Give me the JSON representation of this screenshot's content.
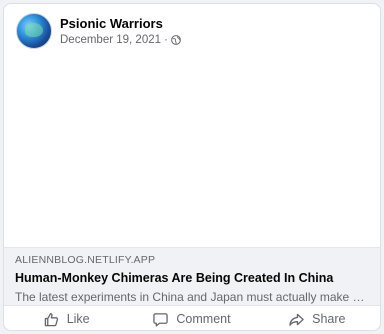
{
  "post": {
    "author": "Psionic Warriors",
    "date": "December 19, 2021",
    "separator": "·",
    "audience_icon": "globe-icon",
    "avatar_icon": "earth-globe-avatar"
  },
  "link_preview": {
    "domain": "ALIENNBLOG.NETLIFY.APP",
    "title": "Human-Monkey Chimeras Are Being Created In China",
    "description": "The latest experiments in China and Japan must actually make us e..."
  },
  "actions": {
    "like_label": "Like",
    "like_icon": "thumbs-up-icon",
    "comment_label": "Comment",
    "comment_icon": "comment-bubble-icon",
    "share_label": "Share",
    "share_icon": "share-arrow-icon"
  },
  "colors": {
    "text_primary": "#050505",
    "text_secondary": "#65676b",
    "preview_background": "#f0f2f5"
  }
}
